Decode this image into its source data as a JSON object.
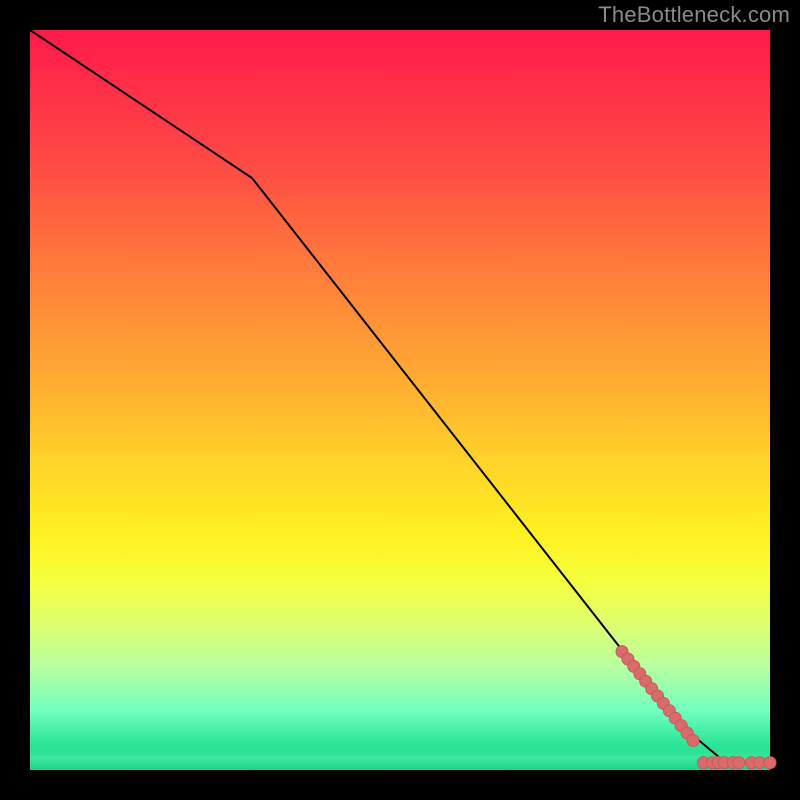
{
  "watermark": "TheBottleneck.com",
  "colors": {
    "line": "#000000",
    "marker_fill": "#d96b6b",
    "marker_stroke": "#c75a5a"
  },
  "chart_data": {
    "type": "line",
    "title": "",
    "xlabel": "",
    "ylabel": "",
    "xlim": [
      0,
      100
    ],
    "ylim": [
      0,
      100
    ],
    "grid": false,
    "legend": false,
    "series": [
      {
        "name": "curve",
        "x": [
          0,
          30,
          88,
          94,
          100
        ],
        "values": [
          100,
          80,
          6,
          1,
          1
        ]
      }
    ],
    "markers": [
      {
        "x": 80.0,
        "y": 16.0
      },
      {
        "x": 80.8,
        "y": 15.0
      },
      {
        "x": 81.6,
        "y": 14.0
      },
      {
        "x": 82.4,
        "y": 13.0
      },
      {
        "x": 83.2,
        "y": 12.0
      },
      {
        "x": 84.0,
        "y": 11.0
      },
      {
        "x": 84.8,
        "y": 10.0
      },
      {
        "x": 85.6,
        "y": 9.0
      },
      {
        "x": 86.4,
        "y": 8.0
      },
      {
        "x": 87.2,
        "y": 7.0
      },
      {
        "x": 88.0,
        "y": 6.0
      },
      {
        "x": 88.8,
        "y": 5.0
      },
      {
        "x": 89.6,
        "y": 4.0
      },
      {
        "x": 91.0,
        "y": 1.0
      },
      {
        "x": 92.2,
        "y": 1.0
      },
      {
        "x": 93.0,
        "y": 1.0
      },
      {
        "x": 93.8,
        "y": 1.0
      },
      {
        "x": 95.0,
        "y": 1.0
      },
      {
        "x": 95.8,
        "y": 1.0
      },
      {
        "x": 97.5,
        "y": 1.0
      },
      {
        "x": 98.6,
        "y": 1.0
      },
      {
        "x": 100.0,
        "y": 1.0
      }
    ]
  }
}
